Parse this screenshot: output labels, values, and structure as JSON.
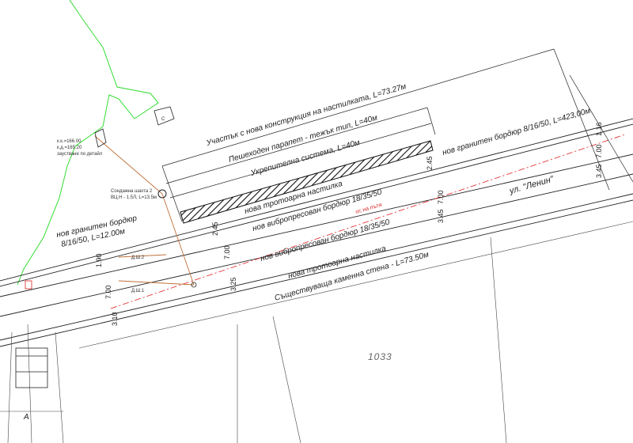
{
  "labels": {
    "section_new_pavement": "Участък с нова конструкция на настилката, L=73.27м",
    "pedestrian_parapet": "Пешеходен парапет - тежък тип, L=40м",
    "retaining_system": "Укрепителна система, L=40м",
    "new_sidewalk_top": "нова тротоарна настилка",
    "new_curb_top": "нов вибропресован бордюр 18/35/50",
    "new_granite_curb_right": "нов гранитен бордюр 8/16/50, L=423,00м",
    "street_name": "ул. \"Ленин\"",
    "new_curb_bottom": "нов вибропресован бордюр 18/35/50",
    "new_sidewalk_bottom": "нова тротоарна настилка",
    "existing_stone_wall": "Съществуваща каменна стена - L=73.50м",
    "new_granite_curb_left_1": "нов гранитен бордюр",
    "new_granite_curb_left_2": "8/16/50, L=12.00м",
    "parcel_number": "1033",
    "road_axis": "ос на пътя",
    "drainage_shaft": "Сондажна шахта 2",
    "drain_pipe": "ВЦ.Н - 1.5Л, L=13.5м",
    "shaft_d1": "Д.Ш.1",
    "shaft_d2": "Д.Ш.2",
    "elev_top": "к.к.=166.00",
    "elev_bottom": "к.д.=165.20",
    "detail_ref": "заустване по детайл",
    "mark_a": "А",
    "mark_c": "С"
  },
  "dimensions": {
    "d_116": "1.16",
    "d_700_right": "7.00",
    "d_345_right": "3.45",
    "d_245_top": "2.45",
    "d_700_mid": "7.00",
    "d_345_mid": "3.45",
    "d_245_left": "2.45",
    "d_700_left": "7.00",
    "d_325": "3.25",
    "d_190": "1.90",
    "d_700_far": "7.00",
    "d_310": "3.10"
  },
  "colors": {
    "line": "#222222",
    "red_axis": "#e02020",
    "green_boundary": "#22dd22",
    "hatch": "#111111",
    "drain": "#c0703a"
  }
}
